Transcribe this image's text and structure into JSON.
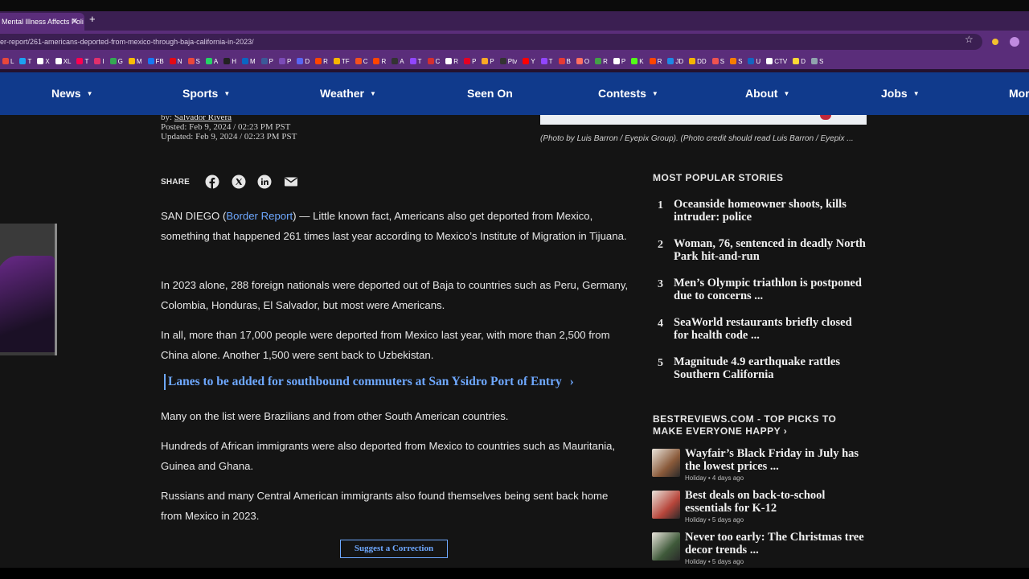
{
  "browser": {
    "tab_title": "Mental Illness Affects Poli",
    "tab_close": "✕",
    "new_tab": "+",
    "url": "er-report/261-americans-deported-from-mexico-through-baja-california-in-2023/",
    "bookmarks": [
      {
        "label": "L",
        "color": "#e9473b"
      },
      {
        "label": "T",
        "color": "#1da1f2"
      },
      {
        "label": "X",
        "color": "#ffffff"
      },
      {
        "label": "XL",
        "color": "#ffffff"
      },
      {
        "label": "T",
        "color": "#ff0050"
      },
      {
        "label": "I",
        "color": "#e1306c"
      },
      {
        "label": "G",
        "color": "#34a853"
      },
      {
        "label": "M",
        "color": "#fbbc05"
      },
      {
        "label": "FB",
        "color": "#1877f2"
      },
      {
        "label": "N",
        "color": "#e50914"
      },
      {
        "label": "S",
        "color": "#e9473b"
      },
      {
        "label": "A",
        "color": "#25d366"
      },
      {
        "label": "H",
        "color": "#222222"
      },
      {
        "label": "M",
        "color": "#0a66c2"
      },
      {
        "label": "P",
        "color": "#3b5998"
      },
      {
        "label": "P",
        "color": "#7b4bb7"
      },
      {
        "label": "D",
        "color": "#5865f2"
      },
      {
        "label": "R",
        "color": "#ff4500"
      },
      {
        "label": "TF",
        "color": "#f7b500"
      },
      {
        "label": "C",
        "color": "#f4511e"
      },
      {
        "label": "R",
        "color": "#ff4500"
      },
      {
        "label": "A",
        "color": "#333333"
      },
      {
        "label": "T",
        "color": "#9146ff"
      },
      {
        "label": "C",
        "color": "#d32f2f"
      },
      {
        "label": "R",
        "color": "#ffffff"
      },
      {
        "label": "P",
        "color": "#e60023"
      },
      {
        "label": "P",
        "color": "#f9a825"
      },
      {
        "label": "Ptv",
        "color": "#333333"
      },
      {
        "label": "Y",
        "color": "#ff0000"
      },
      {
        "label": "T",
        "color": "#9146ff"
      },
      {
        "label": "B",
        "color": "#e53935"
      },
      {
        "label": "O",
        "color": "#ff6f61"
      },
      {
        "label": "R",
        "color": "#43a047"
      },
      {
        "label": "P",
        "color": "#ffffff"
      },
      {
        "label": "K",
        "color": "#53fc18"
      },
      {
        "label": "R",
        "color": "#ff4500"
      },
      {
        "label": "JD",
        "color": "#1e88e5"
      },
      {
        "label": "DD",
        "color": "#f4b400"
      },
      {
        "label": "S",
        "color": "#ef5350"
      },
      {
        "label": "S",
        "color": "#f57c00"
      },
      {
        "label": "U",
        "color": "#1565c0"
      },
      {
        "label": "CTV",
        "color": "#ffffff"
      },
      {
        "label": "D",
        "color": "#fdd835"
      },
      {
        "label": "S",
        "color": "#90a4ae"
      }
    ]
  },
  "nav": {
    "items": [
      {
        "label": "News",
        "caret": "▼"
      },
      {
        "label": "Sports",
        "caret": "▼"
      },
      {
        "label": "Weather",
        "caret": "▼"
      },
      {
        "label": "Seen On",
        "caret": ""
      },
      {
        "label": "Contests",
        "caret": "▼"
      },
      {
        "label": "About",
        "caret": "▼"
      },
      {
        "label": "Jobs",
        "caret": "▼"
      },
      {
        "label": "More",
        "caret": ""
      }
    ]
  },
  "article": {
    "byline_prefix": "by: ",
    "author": "Salvador Rivera",
    "posted": "Posted: Feb 9, 2024 / 02:23 PM PST",
    "updated": "Updated: Feb 9, 2024 / 02:23 PM PST",
    "caption": "(Photo by Luis Barron / Eyepix Group). (Photo credit should read Luis Barron / Eyepix ...",
    "share_label": "SHARE",
    "p1_prefix": "SAN DIEGO (",
    "p1_link": "Border Report",
    "p1_rest": ") — Little known fact, Americans also get deported from Mexico, something that happened 261 times last year according to Mexico’s Institute of Migration in Tijuana.",
    "p2": "In 2023 alone, 288 foreign nationals were deported out of Baja to countries such as Peru, Germany, Colombia, Honduras, El Salvador, but most were Americans.",
    "p3": "In all, more than 17,000 people were deported from Mexico last year, with more than 2,500 from China alone. Another 1,500 were sent back to Uzbekistan.",
    "related_link": "Lanes to be added for southbound commuters at San Ysidro Port of Entry",
    "related_arrow": "›",
    "p4": "Many on the list were Brazilians and from other South American countries.",
    "p5": "Hundreds of African immigrants were also deported from Mexico to countries such as Mauritania, Guinea and Ghana.",
    "p6": "Russians and many Central American immigrants also found themselves being sent back home from Mexico in 2023.",
    "suggest_label": "Suggest a Correction"
  },
  "popular": {
    "title": "MOST POPULAR STORIES",
    "items": [
      {
        "num": "1",
        "title": "Oceanside homeowner shoots, kills intruder: police"
      },
      {
        "num": "2",
        "title": "Woman, 76, sentenced in deadly North Park hit-and-run"
      },
      {
        "num": "3",
        "title": "Men’s Olympic triathlon is postponed due to concerns ..."
      },
      {
        "num": "4",
        "title": "SeaWorld restaurants briefly closed for health code ..."
      },
      {
        "num": "5",
        "title": "Magnitude 4.9 earthquake rattles Southern California"
      }
    ]
  },
  "bestreviews": {
    "title": "BESTREVIEWS.COM - TOP PICKS TO MAKE EVERYONE HAPPY ›",
    "items": [
      {
        "title": "Wayfair’s Black Friday in July has the lowest prices ...",
        "meta": "Holiday • 4 days ago",
        "thumb_color": "#8a5a3a"
      },
      {
        "title": "Best deals on back-to-school essentials for K-12",
        "meta": "Holiday • 5 days ago",
        "thumb_color": "#b8463b"
      },
      {
        "title": "Never too early: The Christmas tree decor trends ...",
        "meta": "Holiday • 5 days ago",
        "thumb_color": "#3f5a3a"
      }
    ]
  }
}
